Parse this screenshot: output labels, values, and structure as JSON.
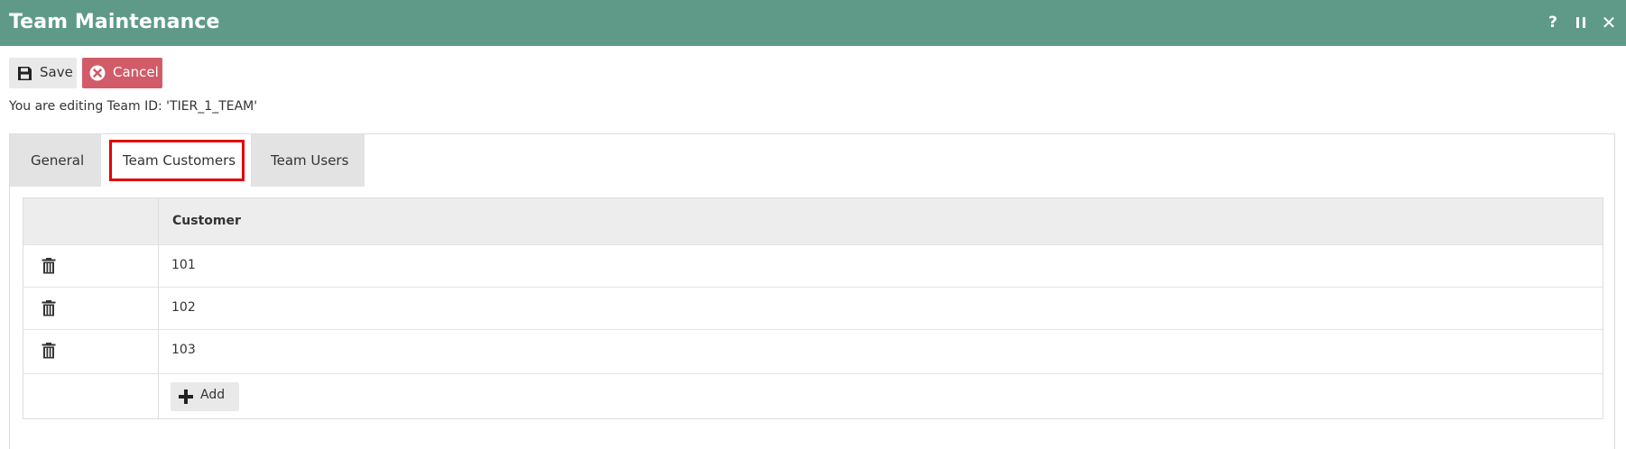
{
  "window": {
    "title": "Team Maintenance",
    "controls": {
      "help": "?",
      "pause": "II",
      "close": "✕"
    }
  },
  "toolbar": {
    "save_label": "Save",
    "cancel_label": "Cancel",
    "save_icon": "floppy-disk-icon",
    "cancel_icon": "close-circle-icon"
  },
  "edit_info": "You are editing Team ID: 'TIER_1_TEAM'",
  "tabs": [
    {
      "label": "General",
      "active": false
    },
    {
      "label": "Team Customers",
      "active": true,
      "highlighted": true
    },
    {
      "label": "Team Users",
      "active": false
    }
  ],
  "grid": {
    "columns": [
      "",
      "Customer"
    ],
    "rows": [
      {
        "customer": "101",
        "delete_icon": "trash-icon"
      },
      {
        "customer": "102",
        "delete_icon": "trash-icon"
      },
      {
        "customer": "103",
        "delete_icon": "trash-icon"
      }
    ],
    "add_label": "Add",
    "add_icon": "plus-icon"
  },
  "colors": {
    "titlebar": "#5f9a88",
    "cancel_button": "#d15b68",
    "highlight_border": "#e30000",
    "tab_inactive": "#e3e3e3",
    "grid_header": "#ededed"
  }
}
